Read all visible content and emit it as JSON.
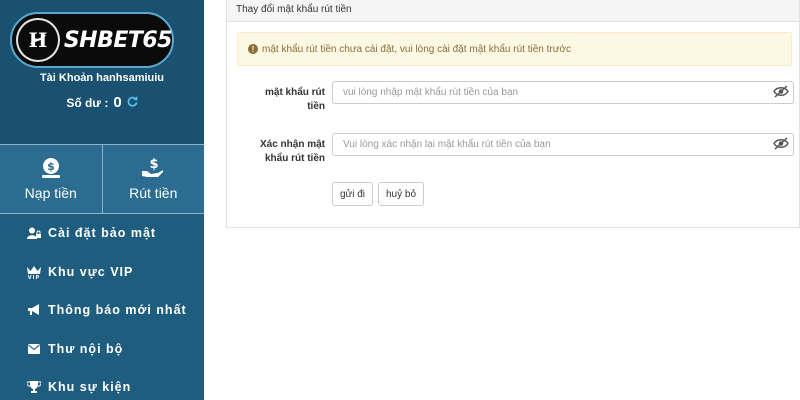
{
  "brand": {
    "logo_text": "SHBET65",
    "colors": {
      "sidebar": "#1f5d7e",
      "sidebar_top": "#1a5070",
      "refresh": "#59c1f2",
      "warning_bg": "#fcf8e3",
      "warning_text": "#8a6d3b"
    }
  },
  "account": {
    "label": "Tài Khoản hanhsamiuiu",
    "balance_label": "Số dư :",
    "balance_value": "0",
    "refresh_icon": "refresh-icon"
  },
  "funds": {
    "deposit_label": "Nạp tiền",
    "deposit_icon": "money-bag-icon",
    "withdraw_label": "Rút tiền",
    "withdraw_icon": "hand-dollar-icon"
  },
  "menu": {
    "items": [
      {
        "label": "Cài đặt bảo mật",
        "icon": "user-lock-icon"
      },
      {
        "label": "Khu vực VIP",
        "icon": "crown-vip-icon"
      },
      {
        "label": "Thông báo mới nhất",
        "icon": "megaphone-icon"
      },
      {
        "label": "Thư nội bộ",
        "icon": "envelope-icon"
      },
      {
        "label": "Khu sự kiện",
        "icon": "trophy-icon"
      }
    ]
  },
  "panel": {
    "title": "Thay đổi mật khẩu rút tiền",
    "warning": "mật khẩu rút tiền chưa cài đặt, vui lòng cài đặt mật khẩu rút tiền trước",
    "fields": [
      {
        "label_line1": "mật khẩu rút",
        "label_line2": "tiền",
        "placeholder": "vui lòng nhập mật khẩu rút tiền của bạn"
      },
      {
        "label_line1": "Xác nhận mật",
        "label_line2": "khẩu rút tiền",
        "placeholder": "Vui lòng xác nhận lại mật khẩu rút tiền của bạn"
      }
    ],
    "submit_label": "gửi đi",
    "cancel_label": "huỷ bỏ"
  }
}
